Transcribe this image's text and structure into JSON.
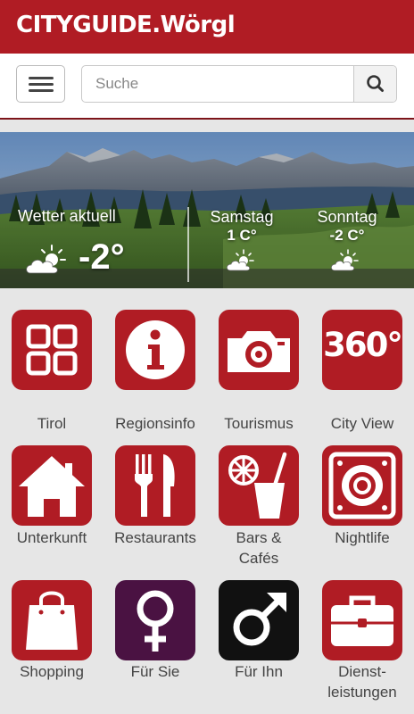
{
  "app": {
    "logo": "CITYGUIDE.Wörgl"
  },
  "search": {
    "placeholder": "Suche"
  },
  "weather": {
    "current_label": "Wetter aktuell",
    "current_temp": "-2°",
    "forecast": [
      {
        "day": "Samstag",
        "temp": "1 C°"
      },
      {
        "day": "Sonntag",
        "temp": "-2 C°"
      }
    ]
  },
  "tiles": [
    {
      "label": "Tirol",
      "icon": "grid-icon",
      "color": "#b01c24"
    },
    {
      "label": "Regionsinfo",
      "icon": "info-icon",
      "color": "#b01c24"
    },
    {
      "label": "Tourismus",
      "icon": "camera-icon",
      "color": "#b01c24"
    },
    {
      "label": "City View",
      "icon": "360-icon",
      "icon_text": "360°",
      "color": "#b01c24"
    },
    {
      "label": "Unterkunft",
      "icon": "house-icon",
      "color": "#b01c24"
    },
    {
      "label": "Restaurants",
      "icon": "cutlery-icon",
      "color": "#b01c24"
    },
    {
      "label_line1": "Bars &",
      "label_line2": "Cafés",
      "icon": "drink-icon",
      "color": "#b01c24"
    },
    {
      "label": "Nightlife",
      "icon": "speaker-icon",
      "color": "#b01c24"
    },
    {
      "label": "Shopping",
      "icon": "shopping-bag-icon",
      "color": "#b01c24"
    },
    {
      "label": "Für Sie",
      "icon": "female-icon",
      "color": "#4a1242"
    },
    {
      "label": "Für Ihn",
      "icon": "male-icon",
      "color": "#111111"
    },
    {
      "label_line1": "Dienst-",
      "label_line2": "leistungen",
      "icon": "briefcase-icon",
      "color": "#b01c24"
    }
  ]
}
